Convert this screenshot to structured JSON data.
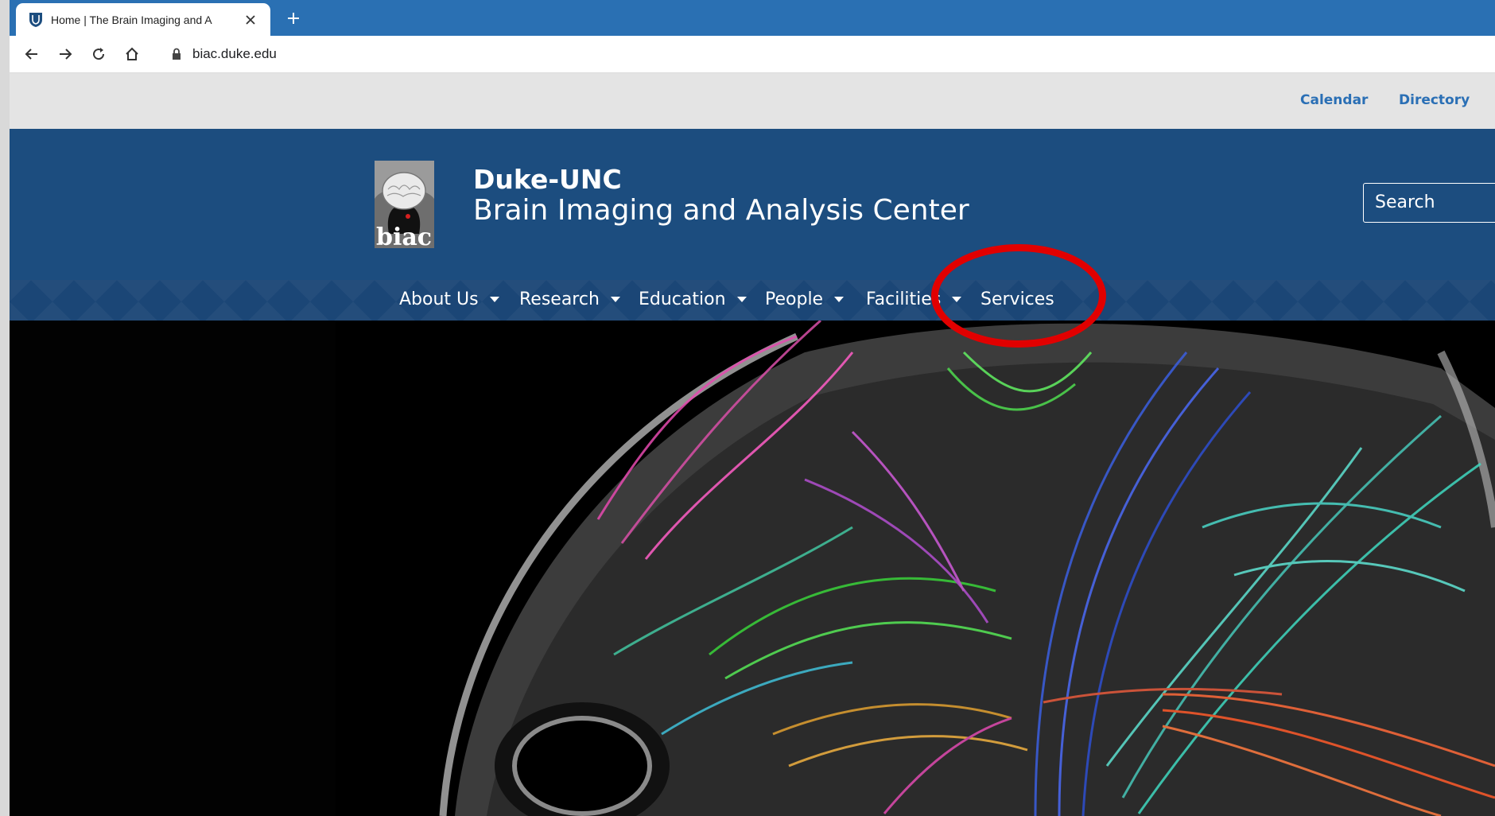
{
  "browser": {
    "tab_title": "Home | The Brain Imaging and A",
    "url": "biac.duke.edu"
  },
  "utility_nav": {
    "items": [
      "Calendar",
      "Directory"
    ]
  },
  "site": {
    "name_line1": "Duke-UNC",
    "name_line2": "Brain Imaging and Analysis Center",
    "logo_text": "biac"
  },
  "search": {
    "placeholder": "Search"
  },
  "main_nav": {
    "items": [
      {
        "label": "About Us",
        "has_dropdown": true
      },
      {
        "label": "Research",
        "has_dropdown": true
      },
      {
        "label": "Education",
        "has_dropdown": true
      },
      {
        "label": "People",
        "has_dropdown": true
      },
      {
        "label": "Facilities",
        "has_dropdown": true
      },
      {
        "label": "Services",
        "has_dropdown": false
      }
    ]
  },
  "annotation": {
    "highlight_color": "#e10000",
    "highlight_target": "Services"
  },
  "colors": {
    "tab_strip": "#2a70b3",
    "header": "#1c4d7f",
    "nav": "#1b4676",
    "utility_link": "#2a6fb5"
  }
}
